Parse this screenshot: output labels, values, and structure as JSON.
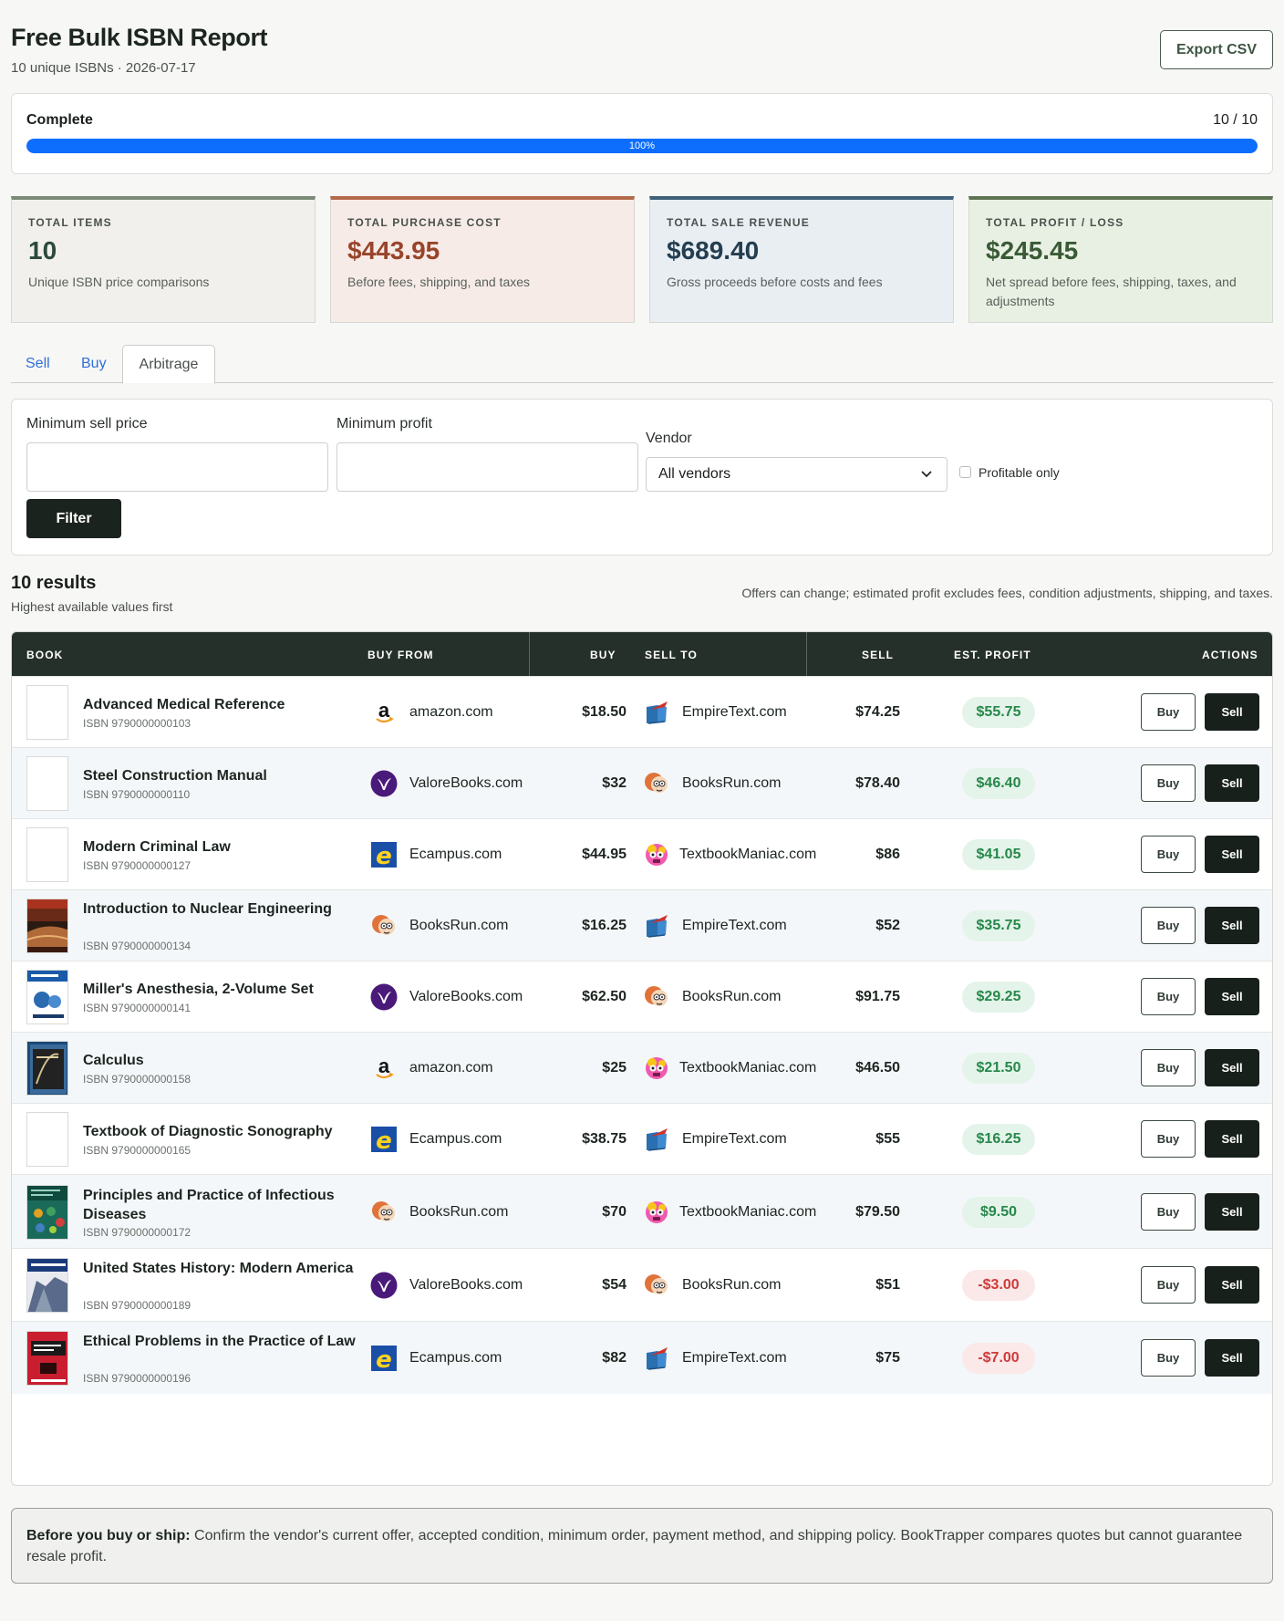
{
  "header": {
    "title": "Free Bulk ISBN Report",
    "subtitle": "10 unique ISBNs · 2026-07-17",
    "export_label": "Export CSV"
  },
  "progress": {
    "label": "Complete",
    "count": "10 / 10",
    "percent_label": "100%",
    "percent": 100
  },
  "stats": [
    {
      "title": "TOTAL ITEMS",
      "value": "10",
      "desc": "Unique ISBN price comparisons",
      "accent": "#7a8a76",
      "bg": "#f1f0ec",
      "color": "#2c4a3a"
    },
    {
      "title": "TOTAL PURCHASE COST",
      "value": "$443.95",
      "desc": "Before fees, shipping, and taxes",
      "accent": "#b36a4a",
      "bg": "#f6ebe6",
      "color": "#98442b"
    },
    {
      "title": "TOTAL SALE REVENUE",
      "value": "$689.40",
      "desc": "Gross proceeds before costs and fees",
      "accent": "#3e6079",
      "bg": "#e8eef2",
      "color": "#243e50"
    },
    {
      "title": "TOTAL PROFIT / LOSS",
      "value": "$245.45",
      "desc": "Net spread before fees, shipping, taxes, and adjustments",
      "accent": "#5d7552",
      "bg": "#e8f0e3",
      "color": "#3a5a36"
    }
  ],
  "tabs": [
    {
      "label": "Sell"
    },
    {
      "label": "Buy"
    },
    {
      "label": "Arbitrage",
      "active": true
    }
  ],
  "filters": {
    "min_sell_label": "Minimum sell price",
    "min_sell_value": "",
    "min_profit_label": "Minimum profit",
    "min_profit_value": "",
    "vendor_label": "Vendor",
    "vendor_value": "All vendors",
    "profitable_label": "Profitable only",
    "filter_button": "Filter"
  },
  "results": {
    "title": "10 results",
    "subtitle": "Highest available values first",
    "note": "Offers can change; estimated profit excludes fees, condition adjustments, shipping, and taxes."
  },
  "table": {
    "headers": {
      "book": "BOOK",
      "buy_from": "BUY FROM",
      "buy": "BUY",
      "sell_to": "SELL TO",
      "sell": "SELL",
      "profit": "EST. PROFIT",
      "actions": "ACTIONS"
    },
    "buy_label": "Buy",
    "sell_label": "Sell",
    "rows": [
      {
        "title": "Advanced Medical Reference",
        "isbn": "ISBN 9790000000103",
        "cover": "blank",
        "buy_from": "amazon.com",
        "buy_logo": "amazon-icon",
        "buy": "$18.50",
        "sell_to": "EmpireText.com",
        "sell_logo": "empiretext-icon",
        "sell": "$74.25",
        "profit": "$55.75",
        "positive": true
      },
      {
        "title": "Steel Construction Manual",
        "isbn": "ISBN 9790000000110",
        "cover": "blank",
        "buy_from": "ValoreBooks.com",
        "buy_logo": "valore-icon",
        "buy": "$32",
        "sell_to": "BooksRun.com",
        "sell_logo": "booksrun-icon",
        "sell": "$78.40",
        "profit": "$46.40",
        "positive": true
      },
      {
        "title": "Modern Criminal Law",
        "isbn": "ISBN 9790000000127",
        "cover": "blank",
        "buy_from": "Ecampus.com",
        "buy_logo": "ecampus-icon",
        "buy": "$44.95",
        "sell_to": "TextbookManiac.com",
        "sell_logo": "textbookmaniac-icon",
        "sell": "$86",
        "profit": "$41.05",
        "positive": true
      },
      {
        "title": "Introduction to Nuclear Engineering",
        "isbn": "ISBN 9790000000134",
        "cover": "nuclear",
        "buy_from": "BooksRun.com",
        "buy_logo": "booksrun-icon",
        "buy": "$16.25",
        "sell_to": "EmpireText.com",
        "sell_logo": "empiretext-icon",
        "sell": "$52",
        "profit": "$35.75",
        "positive": true
      },
      {
        "title": "Miller's Anesthesia, 2-Volume Set",
        "isbn": "ISBN 9790000000141",
        "cover": "anesthesia",
        "buy_from": "ValoreBooks.com",
        "buy_logo": "valore-icon",
        "buy": "$62.50",
        "sell_to": "BooksRun.com",
        "sell_logo": "booksrun-icon",
        "sell": "$91.75",
        "profit": "$29.25",
        "positive": true
      },
      {
        "title": "Calculus",
        "isbn": "ISBN 9790000000158",
        "cover": "calculus",
        "buy_from": "amazon.com",
        "buy_logo": "amazon-icon",
        "buy": "$25",
        "sell_to": "TextbookManiac.com",
        "sell_logo": "textbookmaniac-icon",
        "sell": "$46.50",
        "profit": "$21.50",
        "positive": true
      },
      {
        "title": "Textbook of Diagnostic Sonography",
        "isbn": "ISBN 9790000000165",
        "cover": "blank",
        "buy_from": "Ecampus.com",
        "buy_logo": "ecampus-icon",
        "buy": "$38.75",
        "sell_to": "EmpireText.com",
        "sell_logo": "empiretext-icon",
        "sell": "$55",
        "profit": "$16.25",
        "positive": true
      },
      {
        "title": "Principles and Practice of Infectious Diseases",
        "isbn": "ISBN 9790000000172",
        "cover": "infectious",
        "buy_from": "BooksRun.com",
        "buy_logo": "booksrun-icon",
        "buy": "$70",
        "sell_to": "TextbookManiac.com",
        "sell_logo": "textbookmaniac-icon",
        "sell": "$79.50",
        "profit": "$9.50",
        "positive": true
      },
      {
        "title": "United States History: Modern America",
        "isbn": "ISBN 9790000000189",
        "cover": "history",
        "buy_from": "ValoreBooks.com",
        "buy_logo": "valore-icon",
        "buy": "$54",
        "sell_to": "BooksRun.com",
        "sell_logo": "booksrun-icon",
        "sell": "$51",
        "profit": "-$3.00",
        "positive": false
      },
      {
        "title": "Ethical Problems in the Practice of Law",
        "isbn": "ISBN 9790000000196",
        "cover": "ethics",
        "buy_from": "Ecampus.com",
        "buy_logo": "ecampus-icon",
        "buy": "$82",
        "sell_to": "EmpireText.com",
        "sell_logo": "empiretext-icon",
        "sell": "$75",
        "profit": "-$7.00",
        "positive": false
      }
    ]
  },
  "footer_note": {
    "bold": "Before you buy or ship:",
    "text": " Confirm the vendor's current offer, accepted condition, minimum order, payment method, and shipping policy. BookTrapper compares quotes but cannot guarantee resale profit."
  }
}
